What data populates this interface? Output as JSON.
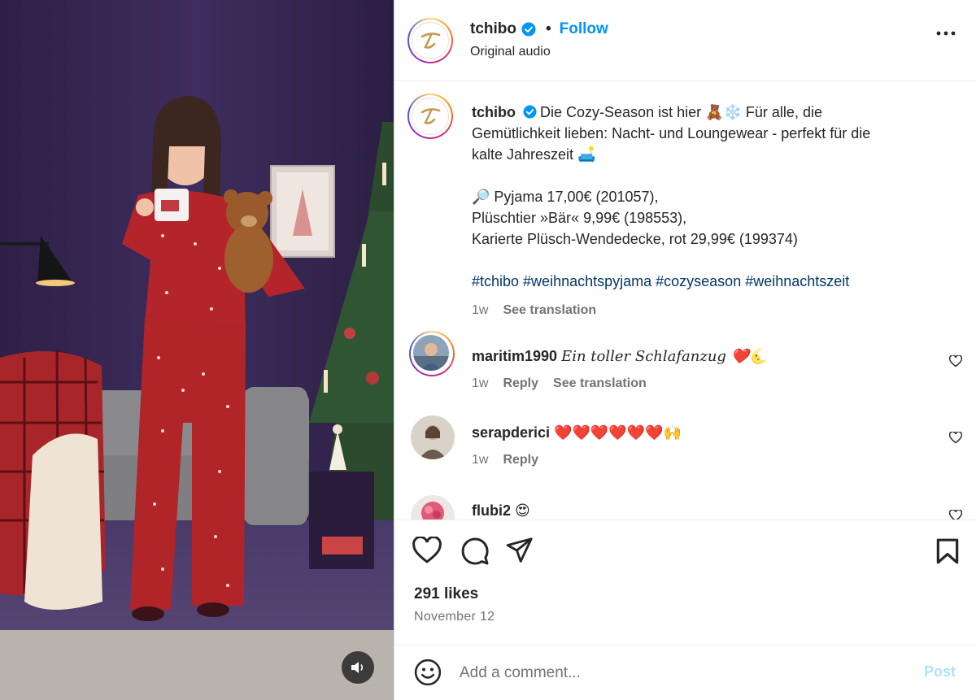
{
  "post": {
    "username": "tchibo",
    "follow_label": "Follow",
    "separator": "•",
    "audio": "Original audio"
  },
  "caption": {
    "username": "tchibo",
    "line1": "Die Cozy-Season ist hier 🧸❄️ Für alle, die",
    "line2": "Gemütlichkeit lieben: Nacht- und Loungewear - perfekt für die",
    "line3": "kalte Jahreszeit 🛋️",
    "product1": "🔎 Pyjama 17,00€ (201057),",
    "product2": "Plüschtier »Bär« 9,99€ (198553),",
    "product3": "Karierte Plüsch-Wendedecke, rot 29,99€ (199374)",
    "hashtags": "#tchibo #weihnachtspyjama #cozyseason #weihnachtszeit",
    "time": "1w",
    "see_translation": "See translation"
  },
  "comments": [
    {
      "username": "maritim1990",
      "text": "Ein toller Schlafanzug ❤️🌜",
      "time": "1w",
      "reply": "Reply",
      "see_translation": "See translation"
    },
    {
      "username": "serapderici",
      "text": "❤️❤️❤️❤️❤️❤️🙌",
      "time": "1w",
      "reply": "Reply"
    },
    {
      "username": "flubi2",
      "text": "😍"
    }
  ],
  "likes": "291 likes",
  "date": "November 12",
  "composer": {
    "placeholder": "Add a comment...",
    "post_label": "Post"
  },
  "icons": {
    "verified": "verified-badge-icon",
    "more": "more-options-icon",
    "like": "heart-icon",
    "comment": "comment-icon",
    "share": "share-icon",
    "save": "bookmark-icon",
    "emoji": "emoji-icon",
    "audio": "speaker-icon"
  },
  "colors": {
    "link_blue": "#0095f6",
    "hashtag": "#00376b",
    "muted": "#737373",
    "post_disabled": "#b2dffc"
  }
}
